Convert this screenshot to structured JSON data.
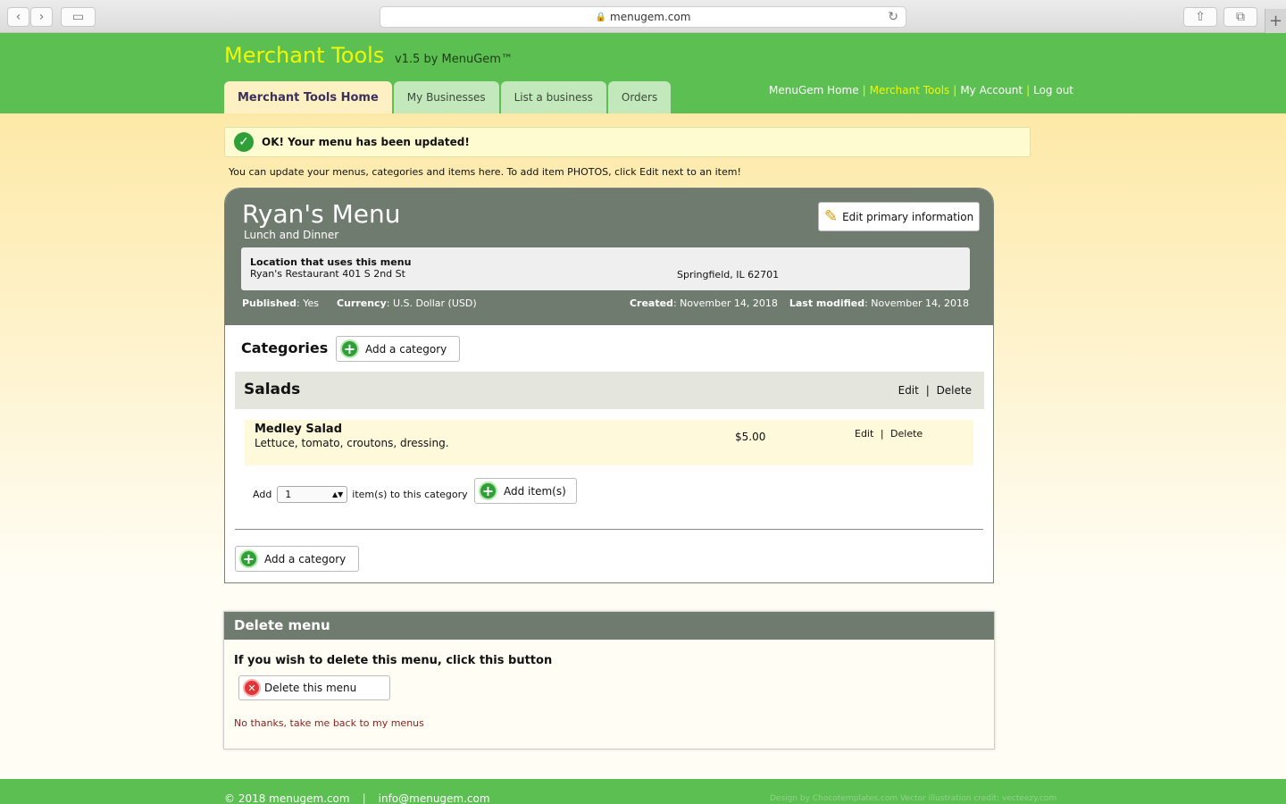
{
  "browser": {
    "url": "menugem.com",
    "back_icon": "chevron-left-icon",
    "forward_icon": "chevron-right-icon"
  },
  "header": {
    "logo": "Merchant Tools",
    "version": "v1.5 by MenuGem™",
    "tabs": [
      {
        "label": "Merchant Tools Home",
        "active": true
      },
      {
        "label": "My Businesses"
      },
      {
        "label": "List a business"
      },
      {
        "label": "Orders"
      }
    ],
    "nav": {
      "home": "MenuGem Home",
      "tools": "Merchant Tools",
      "account": "My Account",
      "logout": "Log out",
      "sep": "|"
    }
  },
  "flash": {
    "message": "OK! Your menu has been updated!"
  },
  "intro": "You can update your menus, categories and items here. To add item PHOTOS, click Edit next to an item!",
  "menu": {
    "title": "Ryan's Menu",
    "subtitle": "Lunch and Dinner",
    "edit_primary": "Edit primary information",
    "location_label": "Location that uses this menu",
    "location_address": "Ryan's Restaurant 401 S 2nd St",
    "location_city": "Springfield, IL 62701",
    "published_label": "Published",
    "published_value": ": Yes",
    "currency_label": "Currency",
    "currency_value": ": U.S. Dollar (USD)",
    "created_label": "Created",
    "created_value": ": November 14, 2018",
    "modified_label": "Last modified",
    "modified_value": ": November 14, 2018"
  },
  "categories": {
    "heading": "Categories",
    "add_label": "Add a category",
    "items": [
      {
        "name": "Salads",
        "edit": "Edit",
        "delete": "Delete",
        "entries": [
          {
            "name": "Medley Salad",
            "description": "Lettuce, tomato, croutons, dressing.",
            "price": "$5.00",
            "edit": "Edit",
            "delete": "Delete"
          }
        ]
      }
    ],
    "add_prefix": "Add",
    "add_qty": "1",
    "add_suffix": "item(s) to this category",
    "add_items_label": "Add item(s)",
    "sep": "|"
  },
  "delete_menu": {
    "heading": "Delete menu",
    "question": "If you wish to delete this menu, click this button",
    "button": "Delete this menu",
    "cancel": "No thanks, take me back to my menus"
  },
  "footer": {
    "copyright": "© 2018 menugem.com",
    "sep": "|",
    "email": "info@menugem.com",
    "credit": "Design by Chocotemplates.com Vector illustration credit: vecteezy.com"
  }
}
